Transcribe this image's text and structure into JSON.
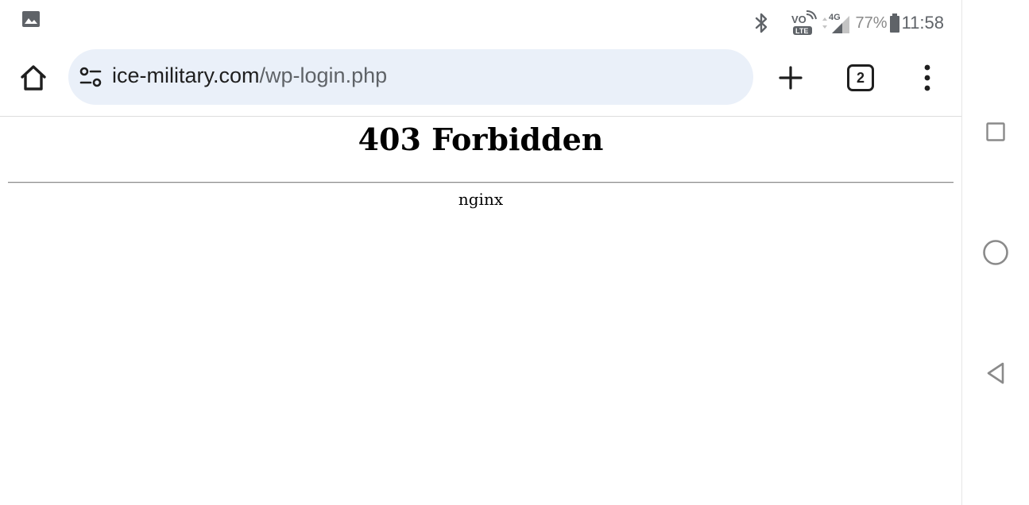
{
  "status_bar": {
    "battery_percent": "77%",
    "time": "11:58",
    "network_label": "4G",
    "volte_label_top": "VO",
    "volte_label_bottom": "LTE",
    "icons": [
      "gallery-icon",
      "bluetooth-icon",
      "volte-icon",
      "signal-4g-icon",
      "battery-icon"
    ]
  },
  "browser": {
    "url_host": "ice-military.com",
    "url_path": "/wp-login.php",
    "tab_count": "2",
    "icons": [
      "home-icon",
      "site-settings-icon",
      "plus-icon",
      "tab-switcher-icon",
      "more-vert-icon"
    ]
  },
  "page": {
    "heading": "403 Forbidden",
    "server_signature": "nginx"
  },
  "nav_bar": {
    "icons": [
      "recents-icon",
      "home-circle-icon",
      "back-icon"
    ]
  },
  "colors": {
    "url_bar_bg": "#eaf0f9",
    "nav_icon": "#8a8a8a",
    "toolbar_icon": "#1f1f1f"
  }
}
